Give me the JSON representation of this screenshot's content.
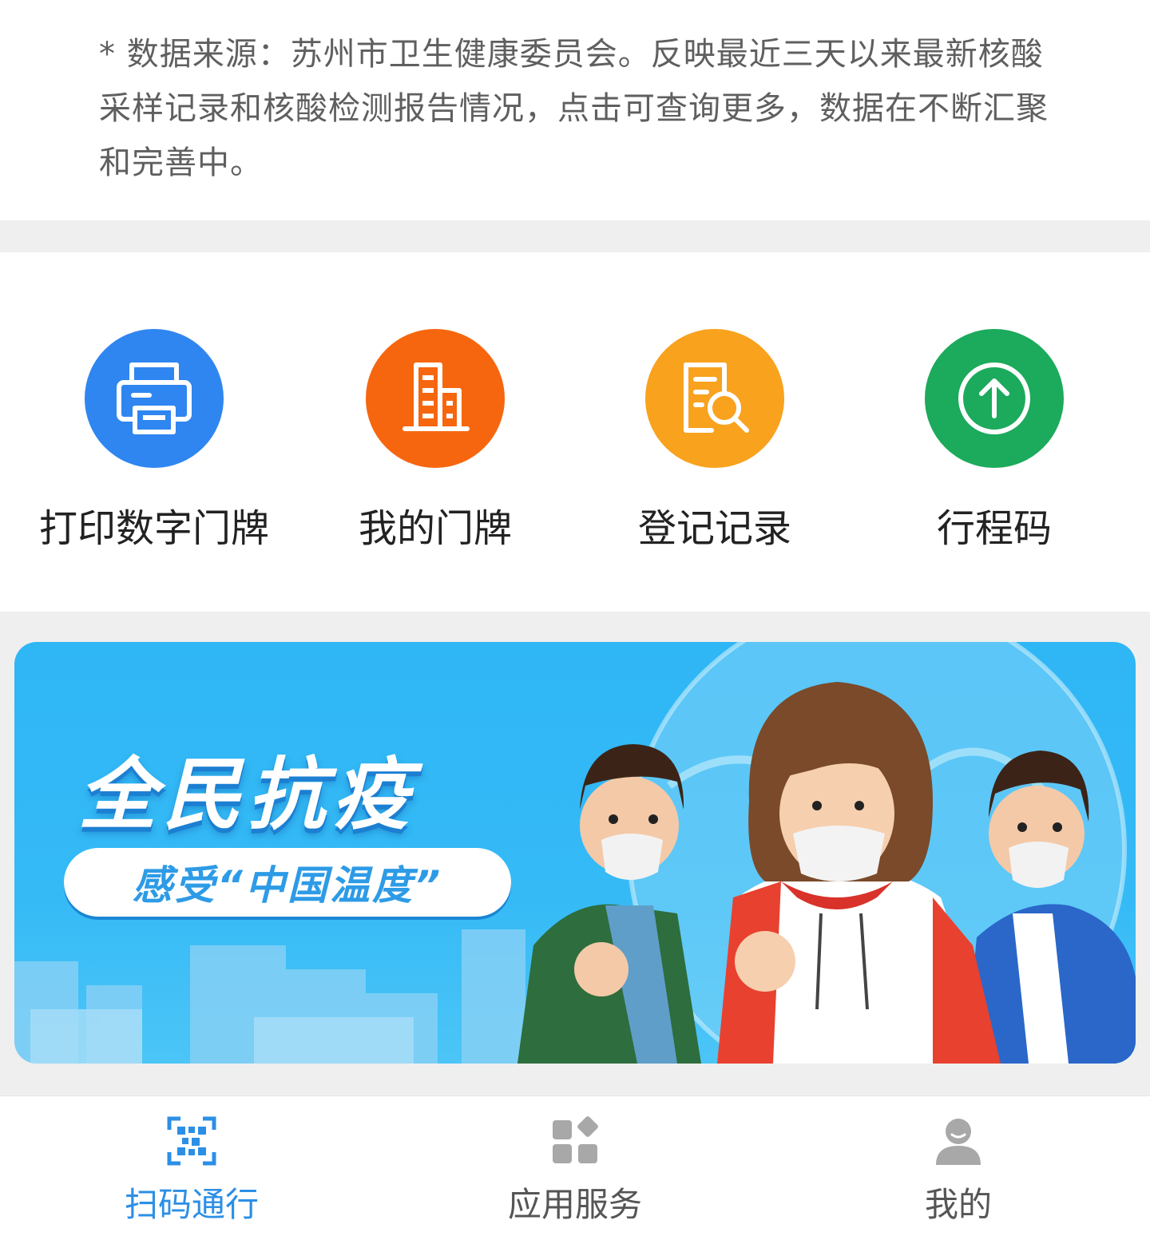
{
  "notice": {
    "text": "* 数据来源：苏州市卫生健康委员会。反映最近三天以来最新核酸采样记录和核酸检测报告情况，点击可查询更多，数据在不断汇聚和完善中。"
  },
  "actions": [
    {
      "label": "打印数字门牌",
      "icon": "printer-icon",
      "color": "#2f86f0"
    },
    {
      "label": "我的门牌",
      "icon": "building-icon",
      "color": "#f6660f"
    },
    {
      "label": "登记记录",
      "icon": "document-search-icon",
      "color": "#f8a21e"
    },
    {
      "label": "行程码",
      "icon": "arrow-up-circle-icon",
      "color": "#1caa5c"
    }
  ],
  "banner": {
    "title": "全民抗疫",
    "subtitle": "感受“中国温度”"
  },
  "tabbar": {
    "active_color": "#2c8fe6",
    "tabs": [
      {
        "label": "扫码通行",
        "icon": "qr-scan-icon",
        "active": true
      },
      {
        "label": "应用服务",
        "icon": "apps-grid-icon",
        "active": false
      },
      {
        "label": "我的",
        "icon": "user-profile-icon",
        "active": false
      }
    ]
  }
}
